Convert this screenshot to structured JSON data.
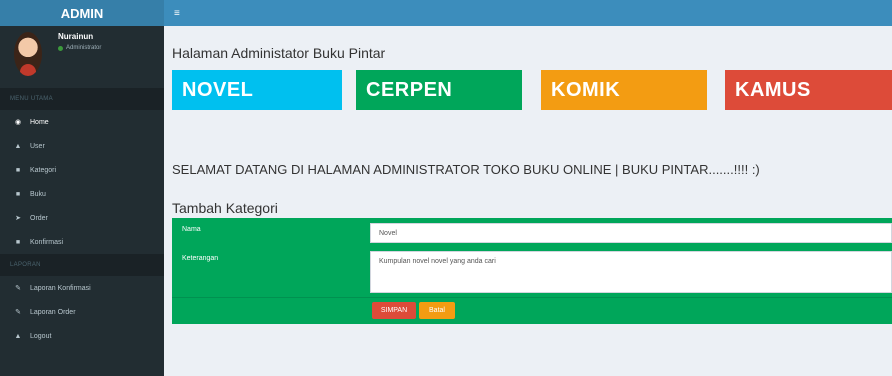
{
  "sidebar": {
    "logo": "ADMIN",
    "user": {
      "name": "Nurainun",
      "role": "Administrator"
    },
    "menu_header_main": "MENU UTAMA",
    "menu_main": [
      {
        "label": "Home",
        "icon": "dashboard-icon"
      },
      {
        "label": "User",
        "icon": "user-icon"
      },
      {
        "label": "Kategori",
        "icon": "folder-icon"
      },
      {
        "label": "Buku",
        "icon": "folder-icon"
      },
      {
        "label": "Order",
        "icon": "send-icon"
      },
      {
        "label": "Konfirmasi",
        "icon": "folder-icon"
      }
    ],
    "menu_header_report": "LAPORAN",
    "menu_report": [
      {
        "label": "Laporan Konfirmasi",
        "icon": "edit-icon"
      },
      {
        "label": "Laporan Order",
        "icon": "edit-icon"
      },
      {
        "label": "Logout",
        "icon": "user-icon"
      }
    ]
  },
  "topbar": {
    "toggle_icon": "hamburger-icon"
  },
  "main": {
    "page_title": "Halaman Administator Buku Pintar",
    "tiles": [
      {
        "label": "NOVEL",
        "color": "#00c0ef"
      },
      {
        "label": "CERPEN",
        "color": "#00a65a"
      },
      {
        "label": "KOMIK",
        "color": "#f39c12"
      },
      {
        "label": "KAMUS",
        "color": "#dd4b39"
      }
    ],
    "welcome": "SELAMAT DATANG DI HALAMAN ADMINISTRATOR TOKO BUKU ONLINE | BUKU PINTAR.......!!!! :)",
    "form": {
      "title": "Tambah Kategori",
      "nama_label": "Nama",
      "nama_value": "Novel",
      "keterangan_label": "Keterangan",
      "keterangan_value": "Kumpulan novel novel yang anda cari",
      "save_label": "SIMPAN",
      "cancel_label": "Batal"
    }
  },
  "colors": {
    "sidebar_bg": "#222d32",
    "topbar_bg": "#3c8dbc",
    "logo_bg": "#367fa9",
    "form_bg": "#00a65a"
  }
}
